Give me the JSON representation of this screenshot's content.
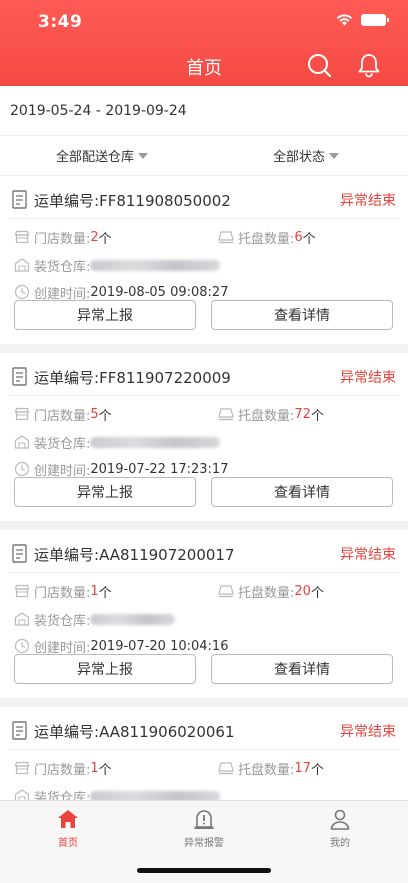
{
  "status_bar": {
    "time": "3:49"
  },
  "nav": {
    "title": "首页"
  },
  "date_range": "2019-05-24 - 2019-09-24",
  "filters": {
    "warehouse": "全部配送仓库",
    "status": "全部状态"
  },
  "labels": {
    "order_no": "运单编号:",
    "store_count": "门店数量:",
    "pallet_count": "托盘数量:",
    "warehouse": "装货仓库:",
    "created": "创建时间:",
    "unit": "个",
    "btn_report": "异常上报",
    "btn_detail": "查看详情"
  },
  "orders": [
    {
      "order_no": "FF811908050002",
      "status": "异常结束",
      "stores": "2",
      "pallets": "6",
      "created": "2019-08-05 09:08:27"
    },
    {
      "order_no": "FF811907220009",
      "status": "异常结束",
      "stores": "5",
      "pallets": "72",
      "created": "2019-07-22 17:23:17"
    },
    {
      "order_no": "AA811907200017",
      "status": "异常结束",
      "stores": "1",
      "pallets": "20",
      "created": "2019-07-20 10:04:16"
    },
    {
      "order_no": "AA811906020061",
      "status": "异常结束",
      "stores": "1",
      "pallets": "17",
      "created": ""
    }
  ],
  "tabbar": [
    {
      "label": "首页",
      "icon": "home-icon",
      "active": true
    },
    {
      "label": "异常报警",
      "icon": "alarm-icon",
      "active": false
    },
    {
      "label": "我的",
      "icon": "user-icon",
      "active": false
    }
  ],
  "colors": {
    "accent": "#f54a44",
    "status_red": "#e8433d"
  }
}
